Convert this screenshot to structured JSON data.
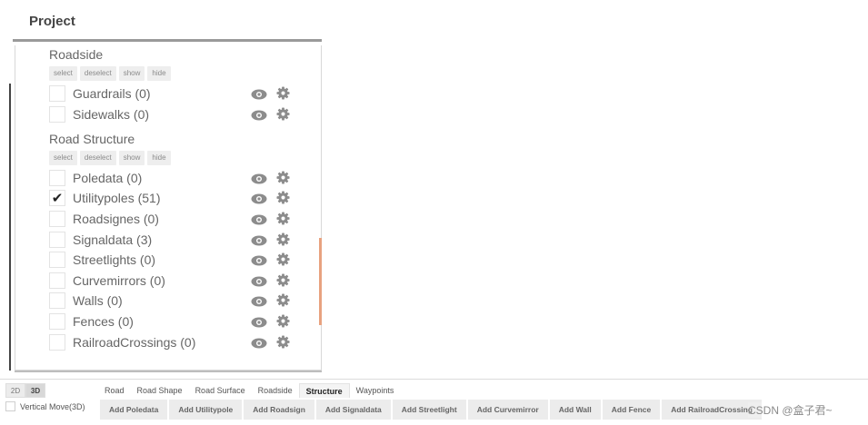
{
  "panel": {
    "title": "Project"
  },
  "sections": [
    {
      "title": "Roadside",
      "buttons": [
        "select",
        "deselect",
        "show",
        "hide"
      ],
      "items": [
        {
          "label": "Guardrails (0)",
          "checked": false
        },
        {
          "label": "Sidewalks (0)",
          "checked": false
        }
      ]
    },
    {
      "title": "Road Structure",
      "buttons": [
        "select",
        "deselect",
        "show",
        "hide"
      ],
      "items": [
        {
          "label": "Poledata (0)",
          "checked": false
        },
        {
          "label": "Utilitypoles (51)",
          "checked": true
        },
        {
          "label": "Roadsignes (0)",
          "checked": false
        },
        {
          "label": "Signaldata (3)",
          "checked": false
        },
        {
          "label": "Streetlights (0)",
          "checked": false
        },
        {
          "label": "Curvemirrors (0)",
          "checked": false
        },
        {
          "label": "Walls (0)",
          "checked": false
        },
        {
          "label": "Fences (0)",
          "checked": false
        },
        {
          "label": "RailroadCrossings (0)",
          "checked": false
        }
      ]
    }
  ],
  "checkmark": "✔",
  "icons": {
    "visibility": "eye-icon",
    "settings": "gear-icon"
  },
  "colors": {
    "scroll_accent": "#e8a27f",
    "icon": "#8c8c8c"
  },
  "toolbar": {
    "modes": [
      {
        "label": "2D",
        "active": false
      },
      {
        "label": "3D",
        "active": true
      }
    ],
    "tabs": [
      {
        "label": "Road",
        "active": false
      },
      {
        "label": "Road Shape",
        "active": false
      },
      {
        "label": "Road Surface",
        "active": false
      },
      {
        "label": "Roadside",
        "active": false
      },
      {
        "label": "Structure",
        "active": true
      },
      {
        "label": "Waypoints",
        "active": false
      }
    ],
    "vertical_move": {
      "label": "Vertical Move(3D)",
      "checked": false
    },
    "add_buttons": [
      "Add Poledata",
      "Add Utilitypole",
      "Add Roadsign",
      "Add Signaldata",
      "Add Streetlight",
      "Add Curvemirror",
      "Add Wall",
      "Add Fence",
      "Add RailroadCrossing"
    ]
  },
  "watermark": "CSDN @盒子君~"
}
